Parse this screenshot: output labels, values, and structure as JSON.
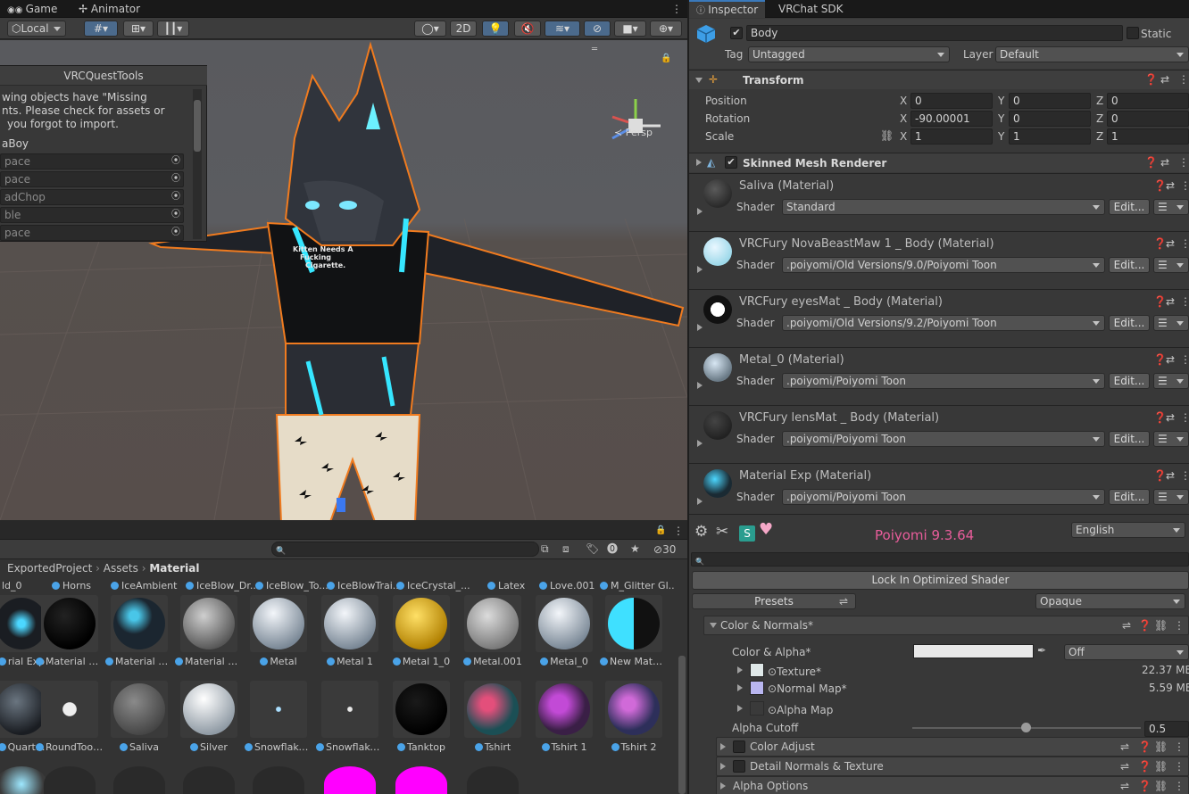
{
  "scene_tabs": {
    "game": "Game",
    "animator": "Animator"
  },
  "scene_toolbar": {
    "pivot": "Local",
    "mode_2d": "2D"
  },
  "gizmo": {
    "persp": "Persp"
  },
  "popup": {
    "title": "VRCQuestTools",
    "msg1": "wing objects have \"Missing",
    "msg2": "nts. Please check for assets or",
    "msg3": "you forgot to import.",
    "root": "aBoy",
    "rows": [
      "pace",
      "pace",
      "adChop",
      "ble",
      "pace"
    ]
  },
  "shirt_text": [
    "Kitten Needs A",
    "Fucking",
    "Cigarette."
  ],
  "project": {
    "hidden_count": "30",
    "breadcrumb": [
      "ExportedProject",
      "Assets",
      "Material"
    ],
    "row0": [
      "ld_0",
      "Horns",
      "IceAmbient",
      "IceBlow_Dr...",
      "IceBlow_To...",
      "IceBlowTrai...",
      "IceCrystal_...",
      "Latex",
      "Love.001",
      "M_Glitter Gl..."
    ],
    "row1": [
      "rial Exp",
      "Material Ex...",
      "Material Ex...",
      "Material Ex...",
      "Metal",
      "Metal 1",
      "Metal 1_0",
      "Metal.001",
      "Metal_0",
      "New Mater..."
    ],
    "row2": [
      "Quart...",
      "RoundToon...",
      "Saliva",
      "Silver",
      "Snowflake_...",
      "Snowflake_...",
      "Tanktop",
      "Tshirt",
      "Tshirt 1",
      "Tshirt 2"
    ]
  },
  "inspector_tabs": {
    "inspector": "Inspector",
    "sdk": "VRChat SDK"
  },
  "object": {
    "name": "Body",
    "static": "Static",
    "tag_label": "Tag",
    "tag": "Untagged",
    "layer_label": "Layer",
    "layer": "Default"
  },
  "transform": {
    "title": "Transform",
    "position": "Position",
    "rotation": "Rotation",
    "scale": "Scale",
    "pos": [
      "0",
      "0",
      "0"
    ],
    "rot": [
      "-90.00001",
      "0",
      "0"
    ],
    "scl": [
      "1",
      "1",
      "1"
    ],
    "axes": [
      "X",
      "Y",
      "Z"
    ]
  },
  "smr": {
    "title": "Skinned Mesh Renderer"
  },
  "shader_label": "Shader",
  "edit_label": "Edit...",
  "materials": [
    {
      "name": "Saliva (Material)",
      "shader": "Standard"
    },
    {
      "name": "VRCFury NovaBeastMaw 1 _ Body (Material)",
      "shader": ".poiyomi/Old Versions/9.0/Poiyomi Toon"
    },
    {
      "name": "VRCFury eyesMat _ Body (Material)",
      "shader": ".poiyomi/Old Versions/9.2/Poiyomi Toon"
    },
    {
      "name": "Metal_0 (Material)",
      "shader": ".poiyomi/Poiyomi Toon"
    },
    {
      "name": "VRCFury lensMat _ Body (Material)",
      "shader": ".poiyomi/Poiyomi Toon"
    },
    {
      "name": "Material Exp (Material)",
      "shader": ".poiyomi/Poiyomi Toon"
    }
  ],
  "poiyomi": {
    "version": "Poiyomi 9.3.64",
    "language": "English",
    "lock": "Lock In Optimized Shader",
    "presets": "Presets",
    "render": "Opaque",
    "color_normals": "Color & Normals*",
    "color_alpha": "Color & Alpha*",
    "off": "Off",
    "texture": "Texture*",
    "texture_size": "22.37 MB",
    "normal": "Normal Map*",
    "normal_size": "5.59 MB",
    "alpha_map": "Alpha Map",
    "alpha_cutoff": "Alpha Cutoff",
    "alpha_cutoff_val": "0.5",
    "color_adjust": "Color Adjust",
    "detail": "Detail Normals & Texture",
    "alpha_options": "Alpha Options"
  },
  "colors": {
    "accent": "#3a79bb",
    "poiyomi_pink": "#e95d9b",
    "selection": "#f07b1f"
  }
}
